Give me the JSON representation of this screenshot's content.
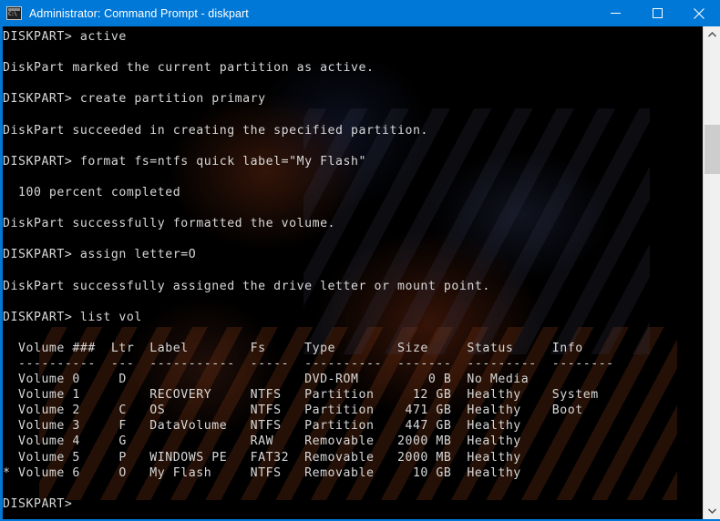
{
  "window": {
    "title": "Administrator: Command Prompt - diskpart",
    "icon": "console-icon",
    "titlebar_color": "#0078d7",
    "background_color": "#000000",
    "text_color": "#d8d8d8"
  },
  "controls": {
    "minimize_label": "Minimize",
    "maximize_label": "Maximize",
    "close_label": "Close"
  },
  "scrollbar": {
    "up_arrow": "scroll-up-arrow",
    "down_arrow": "scroll-down-arrow"
  },
  "terminal": {
    "prompt": "DISKPART>",
    "lines": [
      "DISKPART> active",
      "",
      "DiskPart marked the current partition as active.",
      "",
      "DISKPART> create partition primary",
      "",
      "DiskPart succeeded in creating the specified partition.",
      "",
      "DISKPART> format fs=ntfs quick label=\"My Flash\"",
      "",
      "  100 percent completed",
      "",
      "DiskPart successfully formatted the volume.",
      "",
      "DISKPART> assign letter=O",
      "",
      "DiskPart successfully assigned the drive letter or mount point.",
      "",
      "DISKPART> list vol",
      "",
      "  Volume ###  Ltr  Label        Fs     Type        Size     Status     Info",
      "  ----------  ---  -----------  -----  ----------  -------  ---------  --------",
      "  Volume 0     D                       DVD-ROM         0 B  No Media",
      "  Volume 1         RECOVERY     NTFS   Partition     12 GB  Healthy    System",
      "  Volume 2     C   OS           NTFS   Partition    471 GB  Healthy    Boot",
      "  Volume 3     F   DataVolume   NTFS   Partition    447 GB  Healthy",
      "  Volume 4     G                RAW    Removable   2000 MB  Healthy",
      "  Volume 5     P   WINDOWS PE   FAT32  Removable   2000 MB  Healthy",
      "* Volume 6     O   My Flash     NTFS   Removable     10 GB  Healthy",
      "",
      "DISKPART>"
    ],
    "commands": [
      "active",
      "create partition primary",
      "format fs=ntfs quick label=\"My Flash\"",
      "assign letter=O",
      "list vol"
    ],
    "messages": [
      "DiskPart marked the current partition as active.",
      "DiskPart succeeded in creating the specified partition.",
      "  100 percent completed",
      "DiskPart successfully formatted the volume.",
      "DiskPart successfully assigned the drive letter or mount point."
    ],
    "volume_table": {
      "headers": [
        "Volume ###",
        "Ltr",
        "Label",
        "Fs",
        "Type",
        "Size",
        "Status",
        "Info"
      ],
      "rows": [
        {
          "selected": "",
          "volume": "Volume 0",
          "ltr": "D",
          "label": "",
          "fs": "",
          "type": "DVD-ROM",
          "size": "0 B",
          "status": "No Media",
          "info": ""
        },
        {
          "selected": "",
          "volume": "Volume 1",
          "ltr": "",
          "label": "RECOVERY",
          "fs": "NTFS",
          "type": "Partition",
          "size": "12 GB",
          "status": "Healthy",
          "info": "System"
        },
        {
          "selected": "",
          "volume": "Volume 2",
          "ltr": "C",
          "label": "OS",
          "fs": "NTFS",
          "type": "Partition",
          "size": "471 GB",
          "status": "Healthy",
          "info": "Boot"
        },
        {
          "selected": "",
          "volume": "Volume 3",
          "ltr": "F",
          "label": "DataVolume",
          "fs": "NTFS",
          "type": "Partition",
          "size": "447 GB",
          "status": "Healthy",
          "info": ""
        },
        {
          "selected": "",
          "volume": "Volume 4",
          "ltr": "G",
          "label": "",
          "fs": "RAW",
          "type": "Removable",
          "size": "2000 MB",
          "status": "Healthy",
          "info": ""
        },
        {
          "selected": "",
          "volume": "Volume 5",
          "ltr": "P",
          "label": "WINDOWS PE",
          "fs": "FAT32",
          "type": "Removable",
          "size": "2000 MB",
          "status": "Healthy",
          "info": ""
        },
        {
          "selected": "*",
          "volume": "Volume 6",
          "ltr": "O",
          "label": "My Flash",
          "fs": "NTFS",
          "type": "Removable",
          "size": "10 GB",
          "status": "Healthy",
          "info": ""
        }
      ]
    }
  }
}
